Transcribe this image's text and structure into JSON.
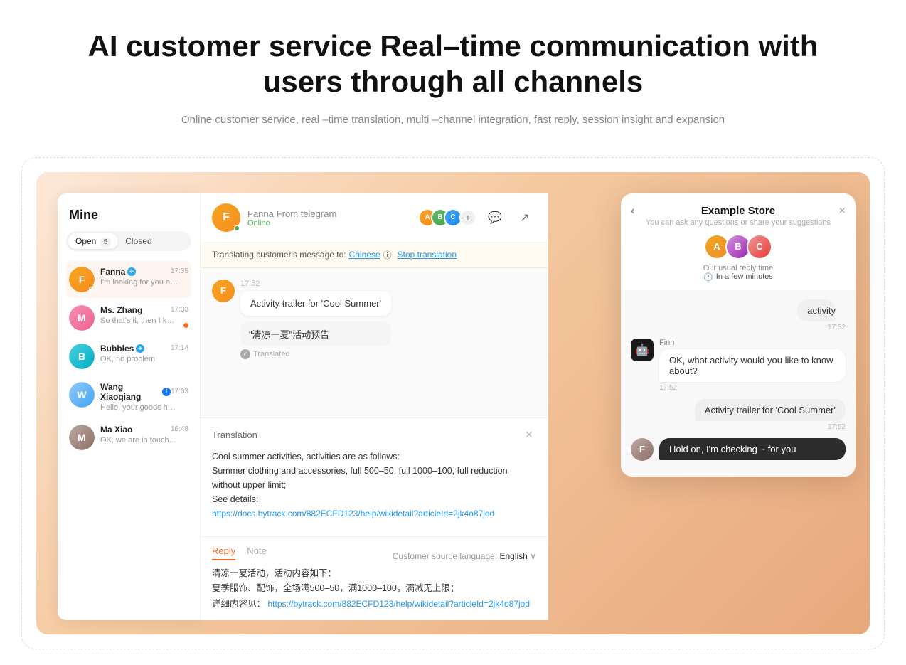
{
  "header": {
    "title": "AI customer service Real–time communication with\nusers through all channels",
    "subtitle": "Online customer service, real –time translation, multi –channel integration, fast reply, session insight and expansion"
  },
  "left_panel": {
    "title": "Mine",
    "tabs": [
      {
        "label": "Open",
        "badge": "5",
        "active": true
      },
      {
        "label": "Closed",
        "active": false
      }
    ],
    "conversations": [
      {
        "name": "Fanna",
        "platform": "telegram",
        "time": "17:35",
        "preview": "I'm looking for you on ...",
        "active": true,
        "has_dot": false,
        "online": true
      },
      {
        "name": "Ms. Zhang",
        "platform": "",
        "time": "17:33",
        "preview": "So that's it, then I know",
        "active": false,
        "has_dot": true,
        "online": false
      },
      {
        "name": "Bubbles",
        "platform": "telegram",
        "time": "17:14",
        "preview": "OK, no problem",
        "active": false,
        "has_dot": false,
        "online": false
      },
      {
        "name": "Wang Xiaoqiang",
        "platform": "facebook",
        "time": "17:03",
        "preview": "Hello, your goods have ...",
        "active": false,
        "has_dot": false,
        "online": false
      },
      {
        "name": "Ma Xiao",
        "platform": "",
        "time": "16:48",
        "preview": "OK, we are in touch...",
        "active": false,
        "has_dot": false,
        "online": false
      }
    ]
  },
  "chat": {
    "contact_name": "Fanna",
    "contact_source": "From telegram",
    "contact_status": "Online",
    "translation_bar": "Translating customer's message to:",
    "translation_lang": "Chinese",
    "stop_translation": "Stop translation",
    "messages": [
      {
        "time": "17:52",
        "text": "Activity trailer for 'Cool Summer'",
        "translated_text": "\"清凉一夏\"活动预告",
        "translated_label": "Translated",
        "from": "customer"
      }
    ],
    "translation_panel": {
      "title": "Translation",
      "body_line1": "Cool summer activities, activities are as follows:",
      "body_line2": "Summer clothing and accessories, full 500–50, full 1000–100, full reduction",
      "body_line3": "without upper limit;",
      "body_line4": "See details:",
      "link": "https://docs.bytrack.com/882ECFD123/help/wikidetail?articleId=2jk4o87jod"
    },
    "reply_tabs": [
      "Reply",
      "Note"
    ],
    "reply_lang_label": "Customer source language:",
    "reply_lang": "English",
    "reply_text_line1": "清凉一夏活动，活动内容如下：",
    "reply_text_line2": "夏季服饰、配饰，全场满500–50，满1000–100，满减无上限；",
    "reply_text_line3": "详细内容见：",
    "reply_link": "https://bytrack.com/882ECFD123/help/wikidetail?articleId=2jk4o87jod"
  },
  "store_widget": {
    "title": "Example Store",
    "subtitle": "You can ask any questions or share your suggestions",
    "reply_time_label": "Our usual reply time",
    "reply_time_value": "In a few minutes",
    "messages": [
      {
        "from": "user",
        "text": "activity",
        "time": "17:52"
      },
      {
        "from": "bot",
        "sender": "Finn",
        "text": "OK, what activity would you like to know about?",
        "time": "17:52"
      },
      {
        "from": "user",
        "text": "Activity trailer for 'Cool Summer'",
        "time": "17:52"
      },
      {
        "from": "bot",
        "sender": "Finn",
        "text": "Hold on, I'm checking ~ for you",
        "time": ""
      }
    ]
  }
}
